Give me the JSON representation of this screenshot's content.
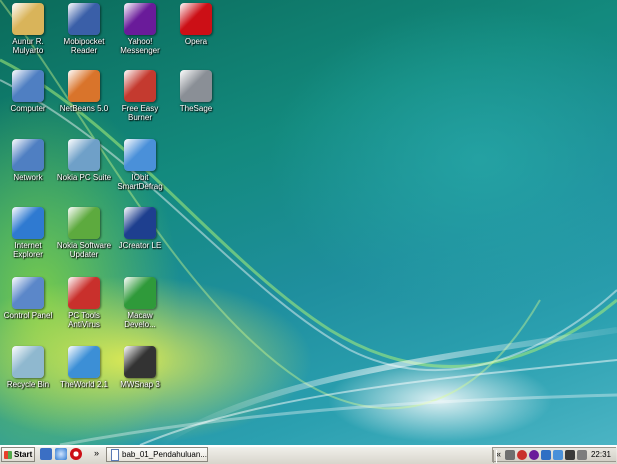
{
  "desktop": {
    "icons": [
      {
        "label": "Aunur R. Mulyarto",
        "name": "user-folder-icon",
        "color": "#d9b45a"
      },
      {
        "label": "Mobipocket Reader",
        "name": "mobipocket-reader-icon",
        "color": "#3a5fa8"
      },
      {
        "label": "Yahoo! Messenger",
        "name": "yahoo-messenger-icon",
        "color": "#6a1b9a"
      },
      {
        "label": "Opera",
        "name": "opera-icon",
        "color": "#cc0f16"
      },
      {
        "label": "Computer",
        "name": "computer-icon",
        "color": "#4f7fc2"
      },
      {
        "label": "NetBeans 5.0",
        "name": "netbeans-icon",
        "color": "#d9742b"
      },
      {
        "label": "Free Easy Burner",
        "name": "free-easy-burner-icon",
        "color": "#c43a2f"
      },
      {
        "label": "TheSage",
        "name": "thesage-icon",
        "color": "#8a8f96"
      },
      {
        "label": "Network",
        "name": "network-icon",
        "color": "#4f7fc2"
      },
      {
        "label": "Nokia PC Suite",
        "name": "nokia-pc-suite-icon",
        "color": "#6fa0c8"
      },
      {
        "label": "IObit SmartDefrag",
        "name": "smartdefrag-icon",
        "color": "#4a90d9"
      },
      {
        "label": "Internet Explorer",
        "name": "internet-explorer-icon",
        "color": "#2f7ad1"
      },
      {
        "label": "Nokia Software Updater",
        "name": "nokia-software-updater-icon",
        "color": "#5daa3e"
      },
      {
        "label": "JCreator LE",
        "name": "jcreator-icon",
        "color": "#1e3f8f"
      },
      {
        "label": "Control Panel",
        "name": "control-panel-icon",
        "color": "#5b87c9"
      },
      {
        "label": "PC Tools AntiVirus",
        "name": "pc-tools-antivirus-icon",
        "color": "#c9302c"
      },
      {
        "label": "Macaw Develo...",
        "name": "macaw-developer-icon",
        "color": "#2f9a3a"
      },
      {
        "label": "Recycle Bin",
        "name": "recycle-bin-icon",
        "color": "#8fb8cf"
      },
      {
        "label": "TheWorld 2.1",
        "name": "theworld-browser-icon",
        "color": "#3c8fd6"
      },
      {
        "label": "MWSnap 3",
        "name": "mwsnap-icon",
        "color": "#333333"
      }
    ]
  },
  "taskbar": {
    "start_label": "Start",
    "window_button_label": "bab_01_Pendahuluan...",
    "quick_launch_more": "»",
    "tray_more": "«",
    "clock": "22:31"
  }
}
